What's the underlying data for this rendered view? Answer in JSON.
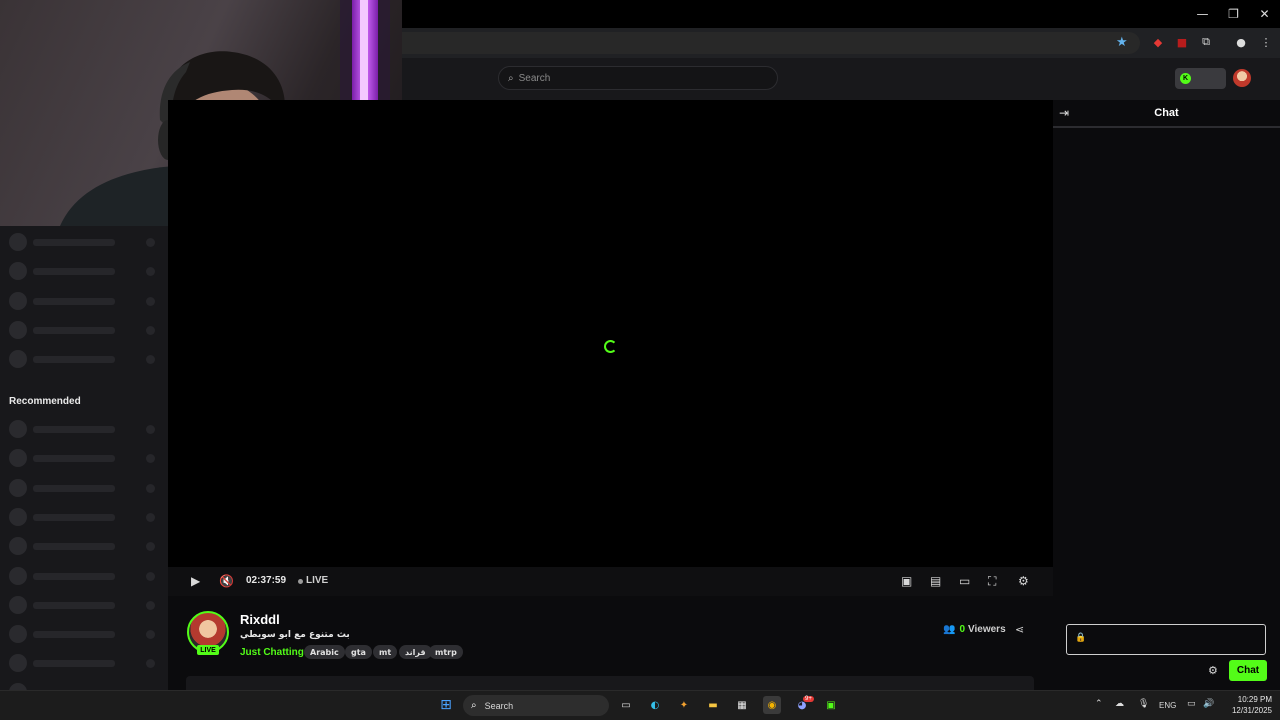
{
  "window": {
    "minimize_glyph": "—",
    "restore_glyph": "❐",
    "close_glyph": "✕"
  },
  "header": {
    "search_placeholder": "Search"
  },
  "sidebar": {
    "recommended_heading": "Recommended"
  },
  "player": {
    "elapsed": "02:37:59",
    "live_label": "LIVE"
  },
  "stream": {
    "streamer_name": "Rixddl",
    "title": "بث متنوع مع ابو سويطي",
    "category": "Just Chatting",
    "live_badge": "LIVE",
    "tags": [
      "Arabic",
      "gta",
      "mt",
      "قراند",
      "mtrp"
    ],
    "viewer_count": "0",
    "viewer_label": "Viewers"
  },
  "chat": {
    "title": "Chat",
    "send_label": "Chat"
  },
  "taskbar": {
    "search_label": "Search",
    "language": "ENG",
    "time": "10:29 PM",
    "date": "12/31/2025",
    "discord_badge": "9+"
  },
  "colors": {
    "brand_green": "#53fc18",
    "page_bg": "#0b0b0d",
    "panel_bg": "#18181b"
  },
  "icons": [
    "search-icon",
    "star-icon",
    "play-icon",
    "mute-icon",
    "pip-icon",
    "theater-icon",
    "fullscreen-icon",
    "settings-icon",
    "share-icon",
    "viewers-icon",
    "lock-icon",
    "chat-collapse-icon"
  ]
}
